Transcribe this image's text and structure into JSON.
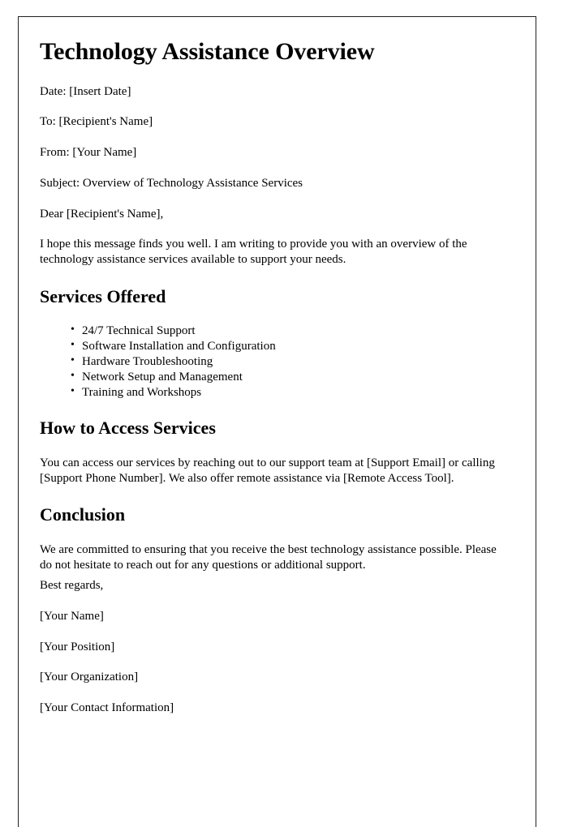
{
  "document": {
    "title": "Technology Assistance Overview",
    "header_lines": [
      "Date: [Insert Date]",
      "To: [Recipient's Name]",
      "From: [Your Name]",
      "Subject: Overview of Technology Assistance Services",
      "Dear [Recipient's Name],"
    ],
    "intro_paragraph": "I hope this message finds you well. I am writing to provide you with an overview of the technology assistance services available to support your needs.",
    "sections": [
      {
        "heading": "Services Offered",
        "items": [
          "24/7 Technical Support",
          "Software Installation and Configuration",
          "Hardware Troubleshooting",
          "Network Setup and Management",
          "Training and Workshops"
        ]
      },
      {
        "heading": "How to Access Services",
        "paragraph": "You can access our services by reaching out to our support team at [Support Email] or calling [Support Phone Number]. We also offer remote assistance via [Remote Access Tool]."
      },
      {
        "heading": "Conclusion",
        "paragraph": "We are committed to ensuring that you receive the best technology assistance possible. Please do not hesitate to reach out for any questions or additional support."
      }
    ],
    "closing": "Best regards,",
    "signature_lines": [
      "[Your Name]",
      "[Your Position]",
      "[Your Organization]",
      "[Your Contact Information]"
    ]
  },
  "style": {
    "page_border_color": "#231f20",
    "page_background": "#ffffff",
    "text_color": "#000000"
  }
}
